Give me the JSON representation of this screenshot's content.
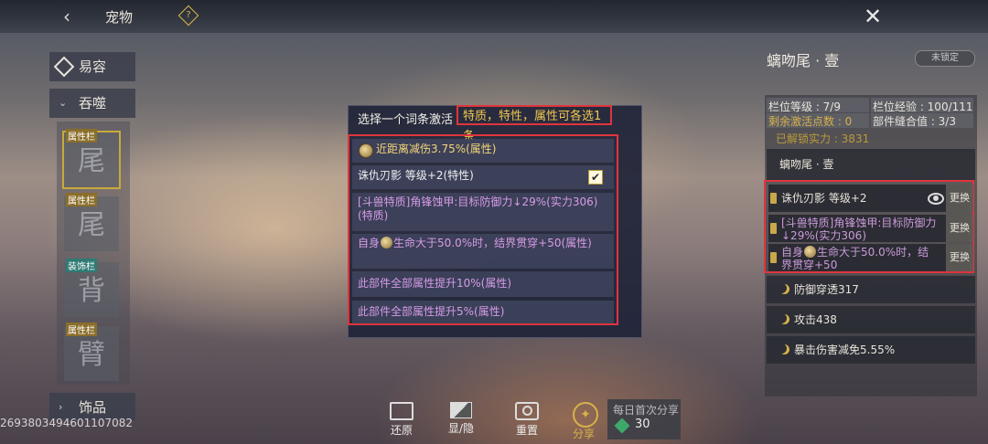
{
  "header": {
    "back_icon": "chevron-left-icon",
    "title": "宠物",
    "help_icon": "question-diamond-icon",
    "close_icon": "close-x-icon"
  },
  "left_nav": {
    "tabs": [
      {
        "label": "易容",
        "icon": "diamond-icon"
      },
      {
        "label": "吞噬",
        "icon": "chevron-down-icon"
      },
      {
        "label": "饰品",
        "icon": "chevron-right-icon"
      }
    ],
    "slots": [
      {
        "tag": "属性栏",
        "glyph": "尾",
        "selected": true
      },
      {
        "tag": "属性栏",
        "glyph": "尾",
        "selected": false
      },
      {
        "tag": "装饰栏",
        "glyph": "背",
        "selected": false
      },
      {
        "tag": "属性栏",
        "glyph": "臂",
        "selected": false
      }
    ],
    "id_text": "2693803494601107082"
  },
  "dialog": {
    "title": "选择一个词条激活",
    "hint": "特质，特性，属性可各选1条",
    "options": [
      {
        "text": "近距离减伤3.75%(属性)",
        "color": "#f2d678",
        "icon": "coin-icon"
      },
      {
        "text": "诛仇刃影 等级+2(特性)",
        "color": "#f0f0f0",
        "checked": true
      },
      {
        "text": "[斗兽特质]角锋蚀甲:目标防御力↓29%(实力306)(特质)",
        "color": "#d79be6"
      },
      {
        "text_a": "自身",
        "text_b": "生命大于50.0%时，结界贯穿+50(属性)",
        "color": "#d79be6"
      },
      {
        "text": "此部件全部属性提升10%(属性)",
        "color": "#d79be6"
      },
      {
        "text": "此部件全部属性提升5%(属性)",
        "color": "#d79be6"
      }
    ]
  },
  "right_panel": {
    "name": "螭吻尾 · 壹",
    "lock_label": "未锁定",
    "stats": {
      "slot_level": "栏位等级 : 7/9",
      "slot_exp": "栏位经验 : 100/111",
      "remaining": "剩余激活点数 : 0",
      "fit": "部件缝合值 : 3/3"
    },
    "unlocked": "已解锁实力 : 3831",
    "sub_title": "螭吻尾 · 壹",
    "active_rows": [
      {
        "text": "诛仇刃影 等级+2",
        "button": "更换",
        "icon": "eye-icon"
      },
      {
        "text": "[斗兽特质]角锋蚀甲:目标防御力↓29%(实力306)",
        "button": "更换"
      },
      {
        "text_a": "自身",
        "text_b": "生命大于50.0%时，结界贯穿+50",
        "button": "更换"
      }
    ],
    "attrs": [
      "防御穿透317",
      "攻击438",
      "暴击伤害减免5.55%"
    ]
  },
  "bottom_bar": {
    "restore": "还原",
    "toggle": "显/隐",
    "reset": "重置",
    "share": "分享",
    "daily_title": "每日首次分享",
    "daily_reward": "30"
  }
}
